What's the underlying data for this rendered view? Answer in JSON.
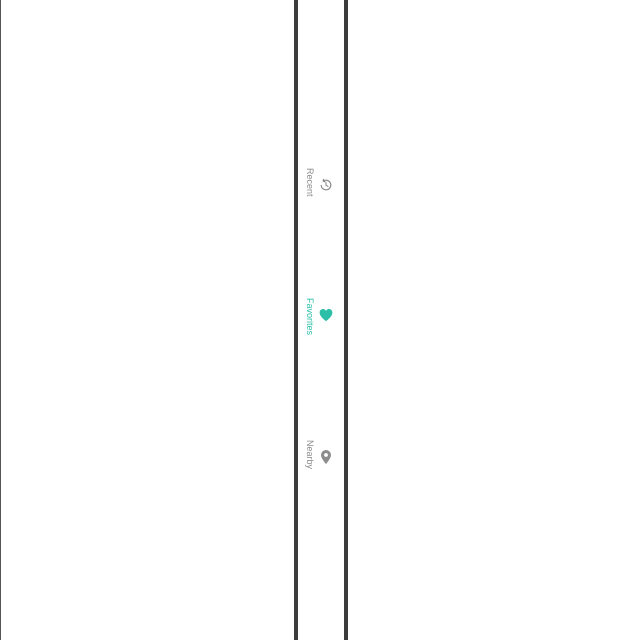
{
  "bottom_nav": {
    "items": [
      {
        "label": "Recent",
        "icon": "history-icon",
        "active": false
      },
      {
        "label": "Favorites",
        "icon": "heart-icon",
        "active": true
      },
      {
        "label": "Nearby",
        "icon": "location-pin-icon",
        "active": false
      }
    ]
  },
  "colors": {
    "active": "#2bbfa8",
    "inactive": "#8c8c8c",
    "frame": "#3c3c3c",
    "background": "#ffffff"
  }
}
